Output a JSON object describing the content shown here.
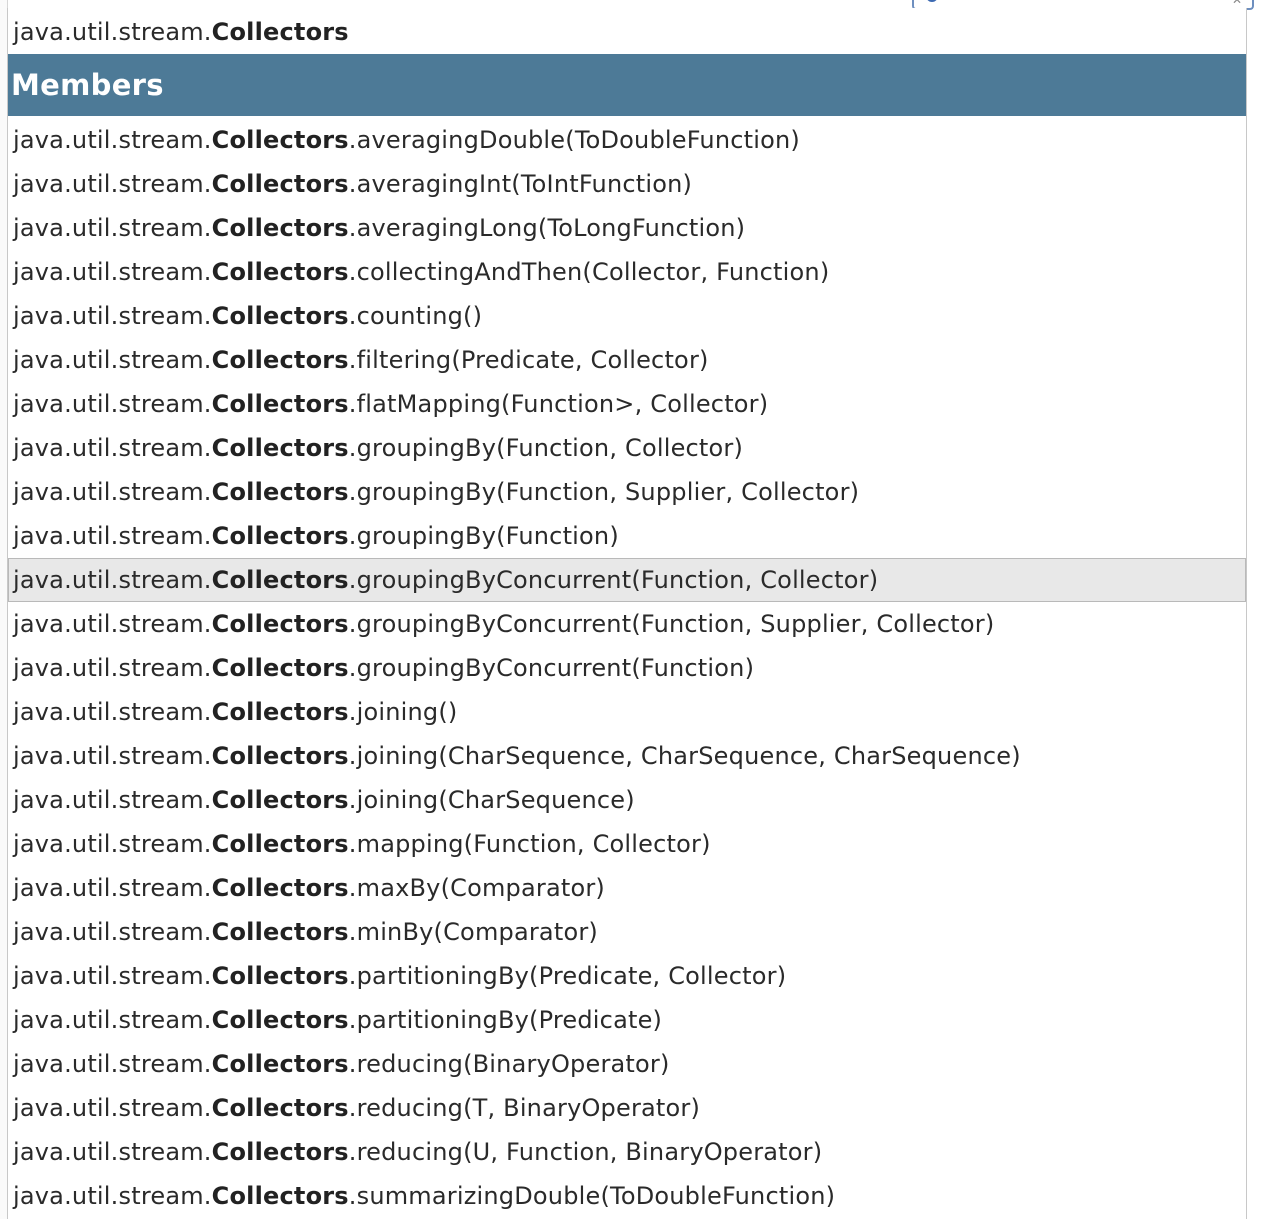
{
  "search": {
    "query_prefix": "java.util.stream.",
    "query_class": "Collectors"
  },
  "category": {
    "label": "Members"
  },
  "members": [
    {
      "prefix": "java.util.stream.",
      "cls": "Collectors",
      "member": ".averagingDouble(ToDoubleFunction)"
    },
    {
      "prefix": "java.util.stream.",
      "cls": "Collectors",
      "member": ".averagingInt(ToIntFunction)"
    },
    {
      "prefix": "java.util.stream.",
      "cls": "Collectors",
      "member": ".averagingLong(ToLongFunction)"
    },
    {
      "prefix": "java.util.stream.",
      "cls": "Collectors",
      "member": ".collectingAndThen(Collector, Function)"
    },
    {
      "prefix": "java.util.stream.",
      "cls": "Collectors",
      "member": ".counting()"
    },
    {
      "prefix": "java.util.stream.",
      "cls": "Collectors",
      "member": ".filtering(Predicate, Collector)"
    },
    {
      "prefix": "java.util.stream.",
      "cls": "Collectors",
      "member": ".flatMapping(Function>, Collector)"
    },
    {
      "prefix": "java.util.stream.",
      "cls": "Collectors",
      "member": ".groupingBy(Function, Collector)"
    },
    {
      "prefix": "java.util.stream.",
      "cls": "Collectors",
      "member": ".groupingBy(Function, Supplier, Collector)"
    },
    {
      "prefix": "java.util.stream.",
      "cls": "Collectors",
      "member": ".groupingBy(Function)"
    },
    {
      "prefix": "java.util.stream.",
      "cls": "Collectors",
      "member": ".groupingByConcurrent(Function, Collector)"
    },
    {
      "prefix": "java.util.stream.",
      "cls": "Collectors",
      "member": ".groupingByConcurrent(Function, Supplier, Collector)"
    },
    {
      "prefix": "java.util.stream.",
      "cls": "Collectors",
      "member": ".groupingByConcurrent(Function)"
    },
    {
      "prefix": "java.util.stream.",
      "cls": "Collectors",
      "member": ".joining()"
    },
    {
      "prefix": "java.util.stream.",
      "cls": "Collectors",
      "member": ".joining(CharSequence, CharSequence, CharSequence)"
    },
    {
      "prefix": "java.util.stream.",
      "cls": "Collectors",
      "member": ".joining(CharSequence)"
    },
    {
      "prefix": "java.util.stream.",
      "cls": "Collectors",
      "member": ".mapping(Function, Collector)"
    },
    {
      "prefix": "java.util.stream.",
      "cls": "Collectors",
      "member": ".maxBy(Comparator)"
    },
    {
      "prefix": "java.util.stream.",
      "cls": "Collectors",
      "member": ".minBy(Comparator)"
    },
    {
      "prefix": "java.util.stream.",
      "cls": "Collectors",
      "member": ".partitioningBy(Predicate, Collector)"
    },
    {
      "prefix": "java.util.stream.",
      "cls": "Collectors",
      "member": ".partitioningBy(Predicate)"
    },
    {
      "prefix": "java.util.stream.",
      "cls": "Collectors",
      "member": ".reducing(BinaryOperator)"
    },
    {
      "prefix": "java.util.stream.",
      "cls": "Collectors",
      "member": ".reducing(T, BinaryOperator)"
    },
    {
      "prefix": "java.util.stream.",
      "cls": "Collectors",
      "member": ".reducing(U, Function, BinaryOperator)"
    },
    {
      "prefix": "java.util.stream.",
      "cls": "Collectors",
      "member": ".summarizingDouble(ToDoubleFunction)"
    }
  ],
  "active_index": 10,
  "icons": {
    "search": "search-icon",
    "clear": "clear-icon"
  },
  "colors": {
    "category_bg": "#4d7a97",
    "active_bg": "#e8e8e8"
  }
}
